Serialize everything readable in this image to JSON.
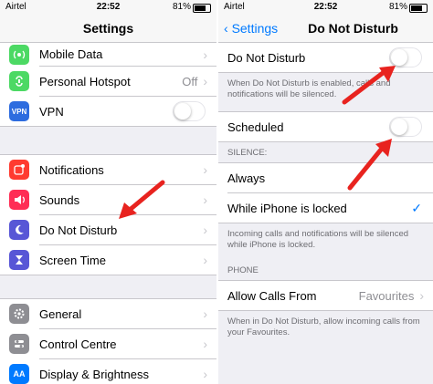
{
  "status": {
    "carrier": "Airtel",
    "time": "22:52",
    "battery": "81%"
  },
  "left": {
    "title": "Settings",
    "group1": [
      {
        "label": "Mobile Data",
        "icon": "antenna-icon",
        "color": "#4cd964",
        "chev": "›"
      },
      {
        "label": "Personal Hotspot",
        "icon": "hotspot-icon",
        "color": "#4cd964",
        "detail": "Off",
        "chev": "›"
      },
      {
        "label": "VPN",
        "icon": "vpn-icon",
        "color": "#2d6cdf",
        "icon_text": "VPN"
      }
    ],
    "group2": [
      {
        "label": "Notifications",
        "icon": "notifications-icon",
        "color": "#ff3b30",
        "chev": "›"
      },
      {
        "label": "Sounds",
        "icon": "speaker-icon",
        "color": "#ff2d55",
        "chev": "›"
      },
      {
        "label": "Do Not Disturb",
        "icon": "moon-icon",
        "color": "#5856d6",
        "chev": "›"
      },
      {
        "label": "Screen Time",
        "icon": "hourglass-icon",
        "color": "#5856d6",
        "chev": "›"
      }
    ],
    "group3": [
      {
        "label": "General",
        "icon": "gear-icon",
        "color": "#8e8e93",
        "chev": "›"
      },
      {
        "label": "Control Centre",
        "icon": "switches-icon",
        "color": "#8e8e93",
        "chev": "›"
      },
      {
        "label": "Display & Brightness",
        "icon": "aa-icon",
        "color": "#007aff",
        "icon_text": "AA",
        "chev": "›"
      }
    ]
  },
  "right": {
    "back": "Settings",
    "title": "Do Not Disturb",
    "dnd_label": "Do Not Disturb",
    "dnd_note": "When Do Not Disturb is enabled, calls and notifications will be silenced.",
    "scheduled_label": "Scheduled",
    "silence_header": "SILENCE:",
    "always_label": "Always",
    "locked_label": "While iPhone is locked",
    "locked_check": "✓",
    "locked_note": "Incoming calls and notifications will be silenced while iPhone is locked.",
    "phone_header": "PHONE",
    "allow_label": "Allow Calls From",
    "allow_value": "Favourites",
    "allow_chev": "›",
    "allow_note": "When in Do Not Disturb, allow incoming calls from your Favourites."
  },
  "colors": {
    "arrow": "#e8231f",
    "accent": "#007aff"
  }
}
